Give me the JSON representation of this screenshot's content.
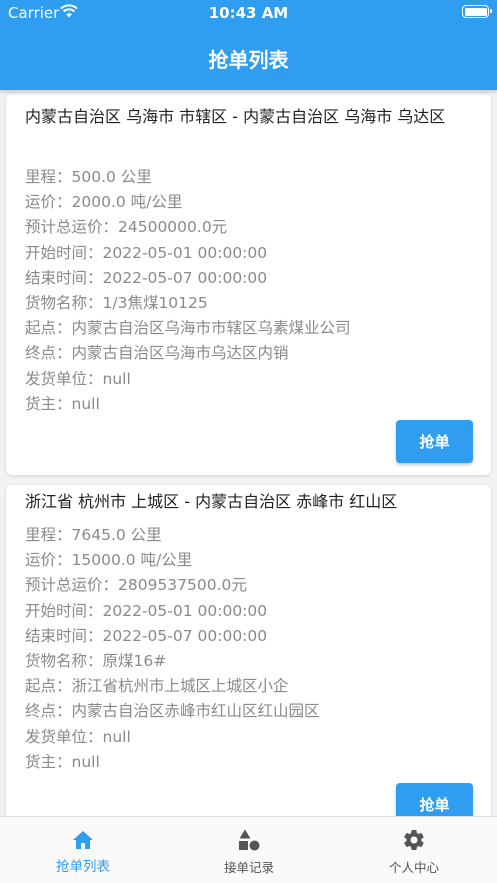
{
  "status_bar": {
    "carrier": "Carrier",
    "time": "10:43 AM"
  },
  "header": {
    "title": "抢单列表"
  },
  "orders": [
    {
      "route": "内蒙古自治区 乌海市 市辖区 - 内蒙古自治区 乌海市 乌达区",
      "fields": [
        "里程：500.0 公里",
        "运价：2000.0 吨/公里",
        "预计总运价：24500000.0元",
        "开始时间：2022-05-01 00:00:00",
        "结束时间：2022-05-07 00:00:00",
        "货物名称：1/3焦煤10125",
        "起点：内蒙古自治区乌海市市辖区乌素煤业公司",
        "终点：内蒙古自治区乌海市乌达区内销",
        "发货单位：null",
        "货主：null"
      ],
      "button_label": "抢单"
    },
    {
      "route": "浙江省 杭州市 上城区 - 内蒙古自治区 赤峰市 红山区",
      "fields": [
        "里程：7645.0 公里",
        "运价：15000.0 吨/公里",
        "预计总运价：2809537500.0元",
        "开始时间：2022-05-01 00:00:00",
        "结束时间：2022-05-07 00:00:00",
        "货物名称：原煤16#",
        "起点：浙江省杭州市上城区上城区小企",
        "终点：内蒙古自治区赤峰市红山区红山园区",
        "发货单位：null",
        "货主：null"
      ],
      "button_label": "抢单"
    }
  ],
  "tabbar": {
    "tabs": [
      {
        "label": "抢单列表",
        "icon": "home-icon",
        "active": true
      },
      {
        "label": "接单记录",
        "icon": "shapes-icon",
        "active": false
      },
      {
        "label": "个人中心",
        "icon": "gear-icon",
        "active": false
      }
    ]
  },
  "colors": {
    "primary": "#2f9df0",
    "text_muted": "#8a8a8a",
    "text": "#222222"
  }
}
